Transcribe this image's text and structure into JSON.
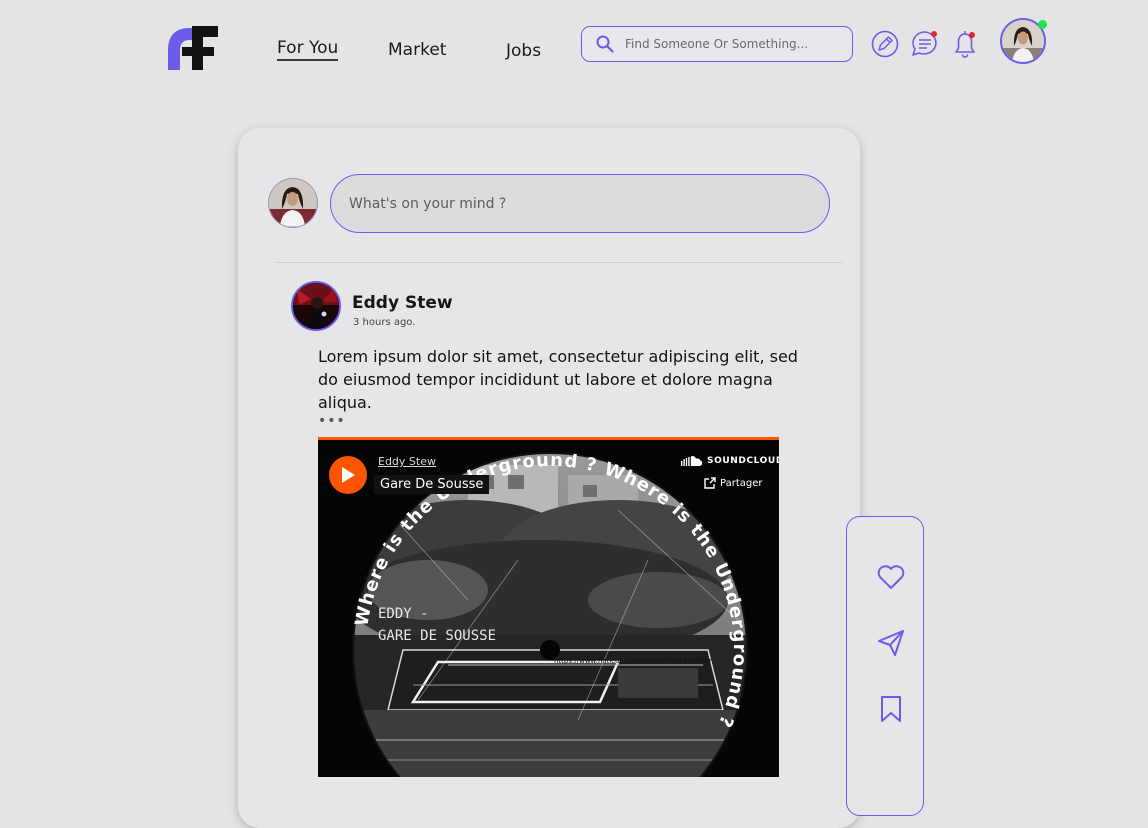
{
  "header": {
    "nav": [
      {
        "label": "For You",
        "active": true
      },
      {
        "label": "Market",
        "active": false
      },
      {
        "label": "Jobs",
        "active": false
      }
    ],
    "search_placeholder": "Find Someone Or Something...",
    "icons": [
      "edit-icon",
      "chat-icon",
      "bell-icon"
    ],
    "accent": "#6c5ce7",
    "notification_dot": "#e0262b",
    "online_dot": "#22e34f"
  },
  "composer": {
    "placeholder": "What's on your mind ?"
  },
  "post": {
    "author": "Eddy Stew",
    "time": "3 hours ago.",
    "text": "Lorem ipsum dolor sit amet, consectetur adipiscing elit, sed do eiusmod tempor incididunt ut labore et dolore magna aliqua.",
    "more": "•••",
    "embed": {
      "user": "Eddy Stew",
      "track": "Gare De Sousse",
      "brand": "SOUNDCLOUD",
      "share": "Partager",
      "art_ring_text": "Where is the Underground ? Where is the Underground ? ",
      "art_title_line1": "EDDY -",
      "art_title_line2": "GARE DE SOUSSE",
      "art_url": "https://www.flaticon.com/uicons?word=slider",
      "brand_color": "#ff5500"
    }
  },
  "actions": [
    "heart-icon",
    "send-icon",
    "bookmark-icon"
  ]
}
